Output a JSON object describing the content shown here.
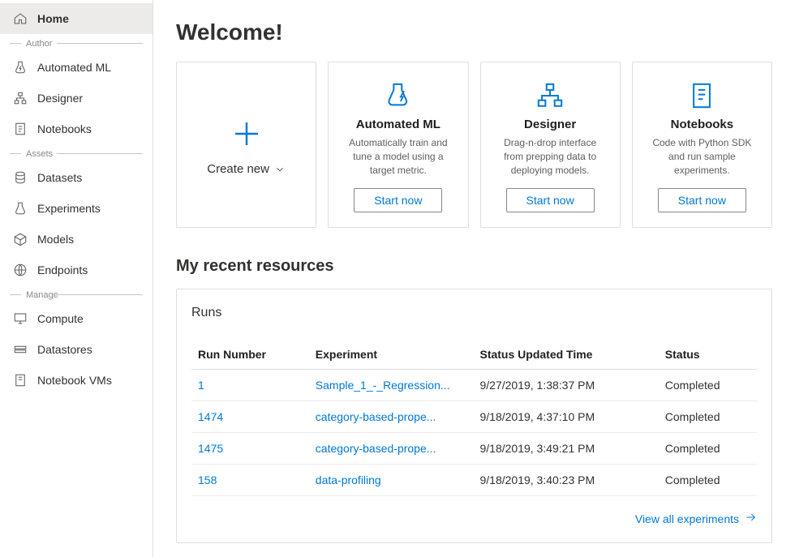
{
  "sidebar": {
    "home_label": "Home",
    "groups": {
      "author": {
        "label": "Author",
        "automated_ml": "Automated ML",
        "designer": "Designer",
        "notebooks": "Notebooks"
      },
      "assets": {
        "label": "Assets",
        "datasets": "Datasets",
        "experiments": "Experiments",
        "models": "Models",
        "endpoints": "Endpoints"
      },
      "manage": {
        "label": "Manage",
        "compute": "Compute",
        "datastores": "Datastores",
        "notebook_vms": "Notebook VMs"
      }
    }
  },
  "main": {
    "welcome_title": "Welcome!",
    "create_new_label": "Create new",
    "cards": {
      "automated_ml": {
        "title": "Automated ML",
        "desc": "Automatically train and tune a model using a target metric.",
        "button": "Start now"
      },
      "designer": {
        "title": "Designer",
        "desc": "Drag-n-drop interface from prepping data to deploying models.",
        "button": "Start now"
      },
      "notebooks": {
        "title": "Notebooks",
        "desc": "Code with Python SDK and run sample experiments.",
        "button": "Start now"
      }
    },
    "recent_title": "My recent resources",
    "runs_title": "Runs",
    "table": {
      "headers": {
        "run_number": "Run Number",
        "experiment": "Experiment",
        "status_time": "Status Updated Time",
        "status": "Status"
      },
      "rows": [
        {
          "run": "1",
          "experiment": "Sample_1_-_Regression...",
          "time": "9/27/2019, 1:38:37 PM",
          "status": "Completed"
        },
        {
          "run": "1474",
          "experiment": "category-based-prope...",
          "time": "9/18/2019, 4:37:10 PM",
          "status": "Completed"
        },
        {
          "run": "1475",
          "experiment": "category-based-prope...",
          "time": "9/18/2019, 3:49:21 PM",
          "status": "Completed"
        },
        {
          "run": "158",
          "experiment": "data-profiling",
          "time": "9/18/2019, 3:40:23 PM",
          "status": "Completed"
        }
      ]
    },
    "view_all_label": "View all experiments"
  },
  "colors": {
    "accent": "#0078d4"
  }
}
